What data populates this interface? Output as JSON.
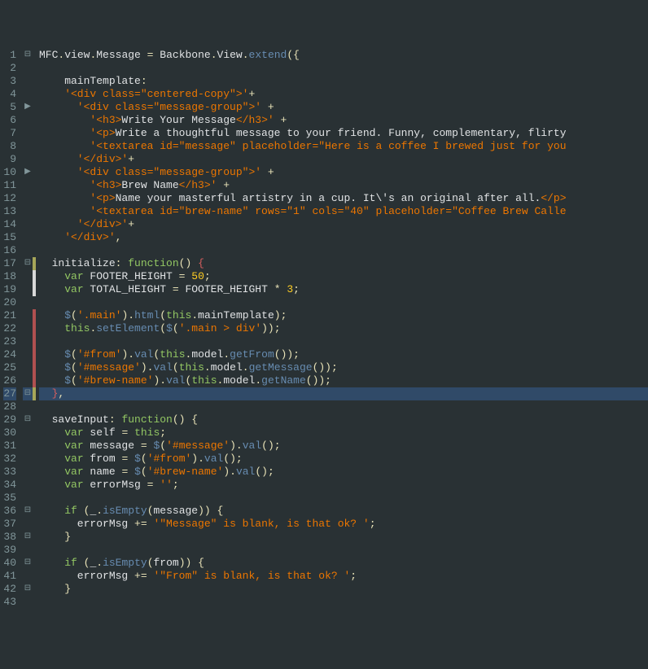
{
  "lines": [
    {
      "n": "1",
      "fold": "⊟",
      "ch": "",
      "code": [
        [
          "var",
          "MFC"
        ],
        [
          "dot",
          "."
        ],
        [
          "var",
          "view"
        ],
        [
          "dot",
          "."
        ],
        [
          "var",
          "Message "
        ],
        [
          "op",
          "="
        ],
        [
          "var",
          " Backbone"
        ],
        [
          "dot",
          "."
        ],
        [
          "var",
          "View"
        ],
        [
          "dot",
          "."
        ],
        [
          "fn",
          "extend"
        ],
        [
          "punc",
          "({"
        ]
      ]
    },
    {
      "n": "2",
      "fold": "",
      "ch": "",
      "code": []
    },
    {
      "n": "3",
      "fold": "",
      "ch": "",
      "code": [
        [
          "var",
          "    mainTemplate"
        ],
        [
          "punc",
          ":"
        ]
      ]
    },
    {
      "n": "4",
      "fold": "",
      "ch": "",
      "code": [
        [
          "str",
          "    '<div class=\"centered-copy\">'"
        ],
        [
          "op",
          "+"
        ]
      ]
    },
    {
      "n": "5",
      "fold": "▶",
      "ch": "",
      "code": [
        [
          "str",
          "      '<div class=\"message-group\">' "
        ],
        [
          "op",
          "+"
        ]
      ]
    },
    {
      "n": "6",
      "fold": "",
      "ch": "",
      "code": [
        [
          "str",
          "        '<h3>"
        ],
        [
          "var",
          "Write Your Message"
        ],
        [
          "str",
          "</h3>' "
        ],
        [
          "op",
          "+"
        ]
      ]
    },
    {
      "n": "7",
      "fold": "",
      "ch": "",
      "code": [
        [
          "str",
          "        '<p>"
        ],
        [
          "var",
          "Write a thoughtful message to your friend. Funny, complementary, flirty"
        ]
      ]
    },
    {
      "n": "8",
      "fold": "",
      "ch": "",
      "code": [
        [
          "str",
          "        '<textarea id=\"message\" placeholder=\"Here is a coffee I brewed just for you"
        ]
      ]
    },
    {
      "n": "9",
      "fold": "",
      "ch": "",
      "code": [
        [
          "str",
          "      '</div>'"
        ],
        [
          "op",
          "+"
        ]
      ]
    },
    {
      "n": "10",
      "fold": "▶",
      "ch": "",
      "code": [
        [
          "str",
          "      '<div class=\"message-group\">' "
        ],
        [
          "op",
          "+"
        ]
      ]
    },
    {
      "n": "11",
      "fold": "",
      "ch": "",
      "code": [
        [
          "str",
          "        '<h3>"
        ],
        [
          "var",
          "Brew Name"
        ],
        [
          "str",
          "</h3>' "
        ],
        [
          "op",
          "+"
        ]
      ]
    },
    {
      "n": "12",
      "fold": "",
      "ch": "",
      "code": [
        [
          "str",
          "        '<p>"
        ],
        [
          "var",
          "Name your masterful artistry in a cup. It\\'s an original after all."
        ],
        [
          "str",
          "</p>"
        ]
      ]
    },
    {
      "n": "13",
      "fold": "",
      "ch": "",
      "code": [
        [
          "str",
          "        '<textarea id=\"brew-name\" rows=\"1\" cols=\"40\" placeholder=\"Coffee Brew Calle"
        ]
      ]
    },
    {
      "n": "14",
      "fold": "",
      "ch": "",
      "code": [
        [
          "str",
          "      '</div>'"
        ],
        [
          "op",
          "+"
        ]
      ]
    },
    {
      "n": "15",
      "fold": "",
      "ch": "",
      "code": [
        [
          "str",
          "    '</div>'"
        ],
        [
          "punc",
          ","
        ]
      ]
    },
    {
      "n": "16",
      "fold": "",
      "ch": "",
      "code": []
    },
    {
      "n": "17",
      "fold": "⊟",
      "ch": "y",
      "code": [
        [
          "var",
          "  initialize"
        ],
        [
          "punc",
          ": "
        ],
        [
          "kw",
          "function"
        ],
        [
          "punc",
          "() "
        ],
        [
          "red",
          "{"
        ]
      ]
    },
    {
      "n": "18",
      "fold": "",
      "ch": "w",
      "code": [
        [
          "var",
          "    "
        ],
        [
          "kw",
          "var"
        ],
        [
          "var",
          " FOOTER_HEIGHT "
        ],
        [
          "op",
          "="
        ],
        [
          "var",
          " "
        ],
        [
          "num",
          "50"
        ],
        [
          "punc",
          ";"
        ]
      ]
    },
    {
      "n": "19",
      "fold": "",
      "ch": "w",
      "code": [
        [
          "var",
          "    "
        ],
        [
          "kw",
          "var"
        ],
        [
          "var",
          " TOTAL_HEIGHT "
        ],
        [
          "op",
          "="
        ],
        [
          "var",
          " FOOTER_HEIGHT "
        ],
        [
          "op",
          "*"
        ],
        [
          "var",
          " "
        ],
        [
          "num",
          "3"
        ],
        [
          "punc",
          ";"
        ]
      ]
    },
    {
      "n": "20",
      "fold": "",
      "ch": "",
      "code": []
    },
    {
      "n": "21",
      "fold": "",
      "ch": "r",
      "code": [
        [
          "var",
          "    "
        ],
        [
          "fn",
          "$"
        ],
        [
          "punc",
          "("
        ],
        [
          "str",
          "'.main'"
        ],
        [
          "punc",
          ")"
        ],
        [
          "dot",
          "."
        ],
        [
          "fn",
          "html"
        ],
        [
          "punc",
          "("
        ],
        [
          "this",
          "this"
        ],
        [
          "dot",
          "."
        ],
        [
          "var",
          "mainTemplate"
        ],
        [
          "punc",
          ");"
        ]
      ]
    },
    {
      "n": "22",
      "fold": "",
      "ch": "r",
      "code": [
        [
          "var",
          "    "
        ],
        [
          "this",
          "this"
        ],
        [
          "dot",
          "."
        ],
        [
          "fn",
          "setElement"
        ],
        [
          "punc",
          "("
        ],
        [
          "fn",
          "$"
        ],
        [
          "punc",
          "("
        ],
        [
          "str",
          "'.main > div'"
        ],
        [
          "punc",
          "));"
        ]
      ]
    },
    {
      "n": "23",
      "fold": "",
      "ch": "r",
      "code": []
    },
    {
      "n": "24",
      "fold": "",
      "ch": "r",
      "code": [
        [
          "var",
          "    "
        ],
        [
          "fn",
          "$"
        ],
        [
          "punc",
          "("
        ],
        [
          "str",
          "'#from'"
        ],
        [
          "punc",
          ")"
        ],
        [
          "dot",
          "."
        ],
        [
          "fn",
          "val"
        ],
        [
          "punc",
          "("
        ],
        [
          "this",
          "this"
        ],
        [
          "dot",
          "."
        ],
        [
          "var",
          "model"
        ],
        [
          "dot",
          "."
        ],
        [
          "fn",
          "getFrom"
        ],
        [
          "punc",
          "());"
        ]
      ]
    },
    {
      "n": "25",
      "fold": "",
      "ch": "r",
      "code": [
        [
          "var",
          "    "
        ],
        [
          "fn",
          "$"
        ],
        [
          "punc",
          "("
        ],
        [
          "str",
          "'#message'"
        ],
        [
          "punc",
          ")"
        ],
        [
          "dot",
          "."
        ],
        [
          "fn",
          "val"
        ],
        [
          "punc",
          "("
        ],
        [
          "this",
          "this"
        ],
        [
          "dot",
          "."
        ],
        [
          "var",
          "model"
        ],
        [
          "dot",
          "."
        ],
        [
          "fn",
          "getMessage"
        ],
        [
          "punc",
          "());"
        ]
      ]
    },
    {
      "n": "26",
      "fold": "",
      "ch": "r",
      "code": [
        [
          "var",
          "    "
        ],
        [
          "fn",
          "$"
        ],
        [
          "punc",
          "("
        ],
        [
          "str",
          "'#brew-name'"
        ],
        [
          "punc",
          ")"
        ],
        [
          "dot",
          "."
        ],
        [
          "fn",
          "val"
        ],
        [
          "punc",
          "("
        ],
        [
          "this",
          "this"
        ],
        [
          "dot",
          "."
        ],
        [
          "var",
          "model"
        ],
        [
          "dot",
          "."
        ],
        [
          "fn",
          "getName"
        ],
        [
          "punc",
          "());"
        ]
      ]
    },
    {
      "n": "27",
      "fold": "⊟",
      "ch": "y",
      "cur": true,
      "code": [
        [
          "var",
          "  "
        ],
        [
          "red",
          "}"
        ],
        [
          "punc",
          ","
        ]
      ]
    },
    {
      "n": "28",
      "fold": "",
      "ch": "",
      "code": []
    },
    {
      "n": "29",
      "fold": "⊟",
      "ch": "",
      "code": [
        [
          "var",
          "  saveInput"
        ],
        [
          "punc",
          ": "
        ],
        [
          "kw",
          "function"
        ],
        [
          "punc",
          "() {"
        ]
      ]
    },
    {
      "n": "30",
      "fold": "",
      "ch": "",
      "code": [
        [
          "var",
          "    "
        ],
        [
          "kw",
          "var"
        ],
        [
          "var",
          " self "
        ],
        [
          "op",
          "="
        ],
        [
          "var",
          " "
        ],
        [
          "this",
          "this"
        ],
        [
          "punc",
          ";"
        ]
      ]
    },
    {
      "n": "31",
      "fold": "",
      "ch": "",
      "code": [
        [
          "var",
          "    "
        ],
        [
          "kw",
          "var"
        ],
        [
          "var",
          " message "
        ],
        [
          "op",
          "="
        ],
        [
          "var",
          " "
        ],
        [
          "fn",
          "$"
        ],
        [
          "punc",
          "("
        ],
        [
          "str",
          "'#message'"
        ],
        [
          "punc",
          ")"
        ],
        [
          "dot",
          "."
        ],
        [
          "fn",
          "val"
        ],
        [
          "punc",
          "();"
        ]
      ]
    },
    {
      "n": "32",
      "fold": "",
      "ch": "",
      "code": [
        [
          "var",
          "    "
        ],
        [
          "kw",
          "var"
        ],
        [
          "var",
          " from "
        ],
        [
          "op",
          "="
        ],
        [
          "var",
          " "
        ],
        [
          "fn",
          "$"
        ],
        [
          "punc",
          "("
        ],
        [
          "str",
          "'#from'"
        ],
        [
          "punc",
          ")"
        ],
        [
          "dot",
          "."
        ],
        [
          "fn",
          "val"
        ],
        [
          "punc",
          "();"
        ]
      ]
    },
    {
      "n": "33",
      "fold": "",
      "ch": "",
      "code": [
        [
          "var",
          "    "
        ],
        [
          "kw",
          "var"
        ],
        [
          "var",
          " name "
        ],
        [
          "op",
          "="
        ],
        [
          "var",
          " "
        ],
        [
          "fn",
          "$"
        ],
        [
          "punc",
          "("
        ],
        [
          "str",
          "'#brew-name'"
        ],
        [
          "punc",
          ")"
        ],
        [
          "dot",
          "."
        ],
        [
          "fn",
          "val"
        ],
        [
          "punc",
          "();"
        ]
      ]
    },
    {
      "n": "34",
      "fold": "",
      "ch": "",
      "code": [
        [
          "var",
          "    "
        ],
        [
          "kw",
          "var"
        ],
        [
          "var",
          " errorMsg "
        ],
        [
          "op",
          "="
        ],
        [
          "var",
          " "
        ],
        [
          "str",
          "''"
        ],
        [
          "punc",
          ";"
        ]
      ]
    },
    {
      "n": "35",
      "fold": "",
      "ch": "",
      "code": []
    },
    {
      "n": "36",
      "fold": "⊟",
      "ch": "",
      "code": [
        [
          "var",
          "    "
        ],
        [
          "kw",
          "if"
        ],
        [
          "var",
          " "
        ],
        [
          "punc",
          "("
        ],
        [
          "var",
          "_"
        ],
        [
          "dot",
          "."
        ],
        [
          "fn",
          "isEmpty"
        ],
        [
          "punc",
          "("
        ],
        [
          "var",
          "message"
        ],
        [
          "punc",
          ")) {"
        ]
      ]
    },
    {
      "n": "37",
      "fold": "",
      "ch": "",
      "code": [
        [
          "var",
          "      errorMsg "
        ],
        [
          "op",
          "+="
        ],
        [
          "var",
          " "
        ],
        [
          "str",
          "'\"Message\" is blank, is that ok? '"
        ],
        [
          "punc",
          ";"
        ]
      ]
    },
    {
      "n": "38",
      "fold": "⊟",
      "ch": "",
      "code": [
        [
          "var",
          "    "
        ],
        [
          "punc",
          "}"
        ]
      ]
    },
    {
      "n": "39",
      "fold": "",
      "ch": "",
      "code": []
    },
    {
      "n": "40",
      "fold": "⊟",
      "ch": "",
      "code": [
        [
          "var",
          "    "
        ],
        [
          "kw",
          "if"
        ],
        [
          "var",
          " "
        ],
        [
          "punc",
          "("
        ],
        [
          "var",
          "_"
        ],
        [
          "dot",
          "."
        ],
        [
          "fn",
          "isEmpty"
        ],
        [
          "punc",
          "("
        ],
        [
          "var",
          "from"
        ],
        [
          "punc",
          ")) {"
        ]
      ]
    },
    {
      "n": "41",
      "fold": "",
      "ch": "",
      "code": [
        [
          "var",
          "      errorMsg "
        ],
        [
          "op",
          "+="
        ],
        [
          "var",
          " "
        ],
        [
          "str",
          "'\"From\" is blank, is that ok? '"
        ],
        [
          "punc",
          ";"
        ]
      ]
    },
    {
      "n": "42",
      "fold": "⊟",
      "ch": "",
      "code": [
        [
          "var",
          "    "
        ],
        [
          "punc",
          "}"
        ]
      ]
    },
    {
      "n": "43",
      "fold": "",
      "ch": "",
      "code": []
    }
  ]
}
